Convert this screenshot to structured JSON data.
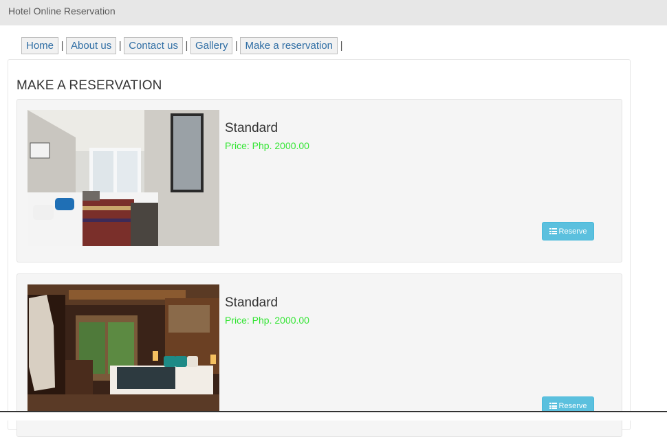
{
  "header": {
    "title": "Hotel Online Reservation"
  },
  "nav": {
    "items": [
      {
        "label": "Home"
      },
      {
        "label": "About us"
      },
      {
        "label": "Contact us"
      },
      {
        "label": "Gallery"
      },
      {
        "label": "Make a reservation"
      }
    ],
    "separator": "|"
  },
  "page": {
    "heading": "MAKE A RESERVATION"
  },
  "rooms": [
    {
      "name": "Standard",
      "price": "Price: Php. 2000.00",
      "button": "Reserve",
      "icon": "list-icon"
    },
    {
      "name": "Standard",
      "price": "Price: Php. 2000.00",
      "button": "Reserve",
      "icon": "list-icon"
    }
  ],
  "colors": {
    "header_bg": "#e7e7e7",
    "link": "#2e6da4",
    "price": "#33e533",
    "button": "#5bc0de",
    "card_bg": "#f5f5f5"
  }
}
